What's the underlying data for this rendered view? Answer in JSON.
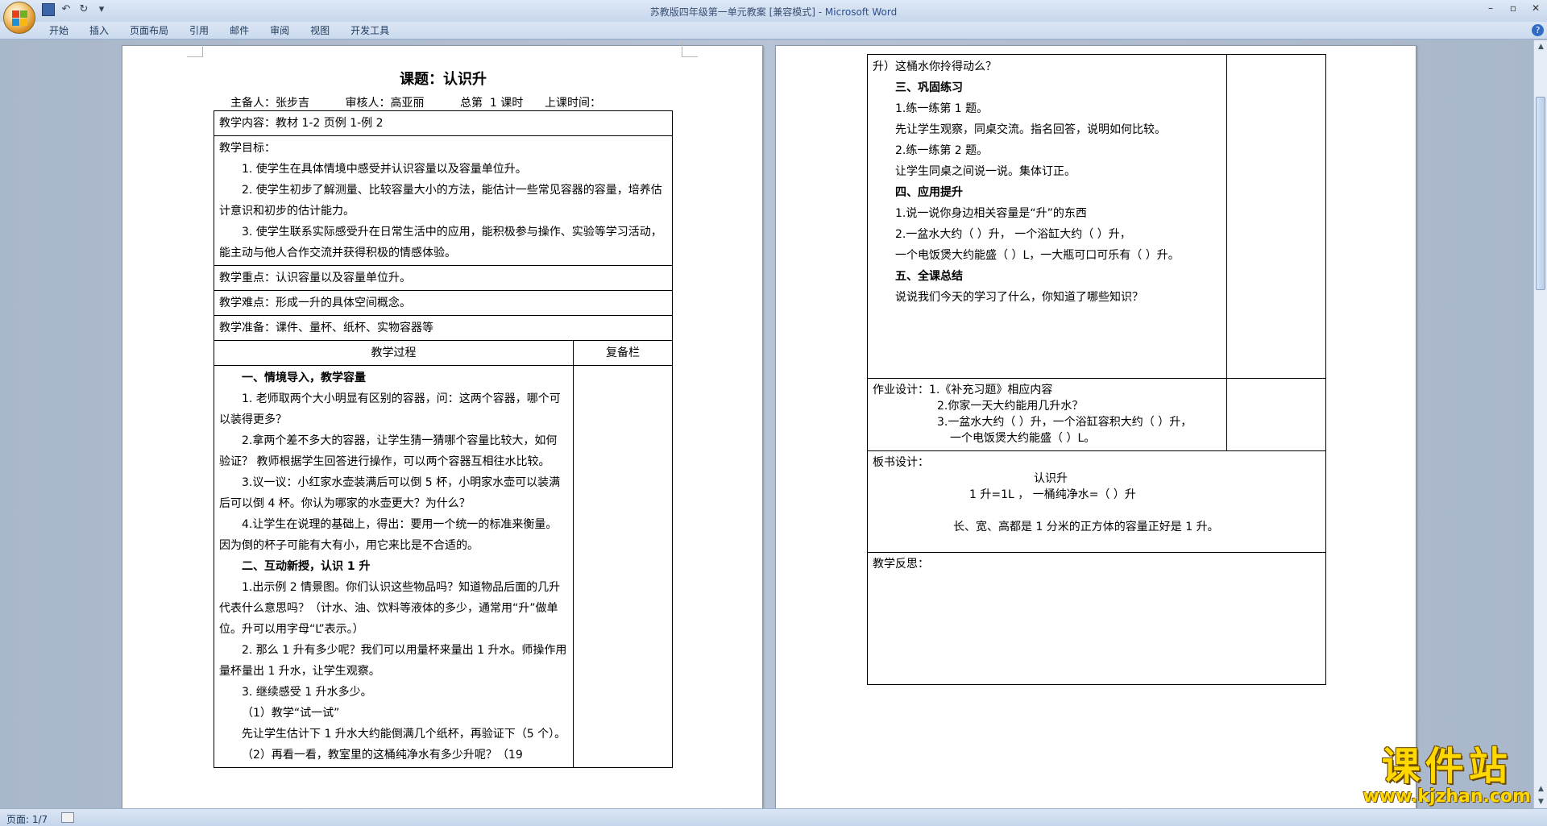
{
  "window": {
    "title_doc": "苏教版四年级第一单元教案 [兼容模式] - ",
    "title_app": "Microsoft Word"
  },
  "ribbon": {
    "tabs": [
      "开始",
      "插入",
      "页面布局",
      "引用",
      "邮件",
      "审阅",
      "视图",
      "开发工具"
    ]
  },
  "status": {
    "page": "页面: 1/7"
  },
  "watermark": {
    "big": "课件站",
    "url": "www.kjzhan.com"
  },
  "page1": {
    "title": "课题：认识升",
    "meta": "主备人：张步吉          审核人：高亚丽          总第  1 课时      上课时间：",
    "content": "教学内容：教材 1-2 页例 1-例 2",
    "goals_heading": "教学目标：",
    "goals": [
      "1. 使学生在具体情境中感受并认识容量以及容量单位升。",
      "2. 使学生初步了解测量、比较容量大小的方法，能估计一些常见容器的容量，培养估计意识和初步的估计能力。",
      "3. 使学生联系实际感受升在日常生活中的应用，能积极参与操作、实验等学习活动，能主动与他人合作交流并获得积极的情感体验。"
    ],
    "key": "教学重点：认识容量以及容量单位升。",
    "difficulty": "教学难点：形成一升的具体空间概念。",
    "prep": "教学准备：课件、量杯、纸杯、实物容器等",
    "process_header": "教学过程",
    "notes_header": "复备栏",
    "process": [
      {
        "bold": true,
        "text": "一、情境导入，教学容量"
      },
      {
        "bold": false,
        "text": "1. 老师取两个大小明显有区别的容器，问：这两个容器，哪个可以装得更多？"
      },
      {
        "bold": false,
        "text": "2.拿两个差不多大的容器，让学生猜一猜哪个容量比较大，如何验证？ 教师根据学生回答进行操作，可以两个容器互相往水比较。"
      },
      {
        "bold": false,
        "text": "3.议一议：小红家水壶装满后可以倒 5 杯，小明家水壶可以装满后可以倒 4 杯。你认为哪家的水壶更大？为什么？"
      },
      {
        "bold": false,
        "text": "4.让学生在说理的基础上，得出：要用一个统一的标准来衡量。因为倒的杯子可能有大有小，用它来比是不合适的。"
      },
      {
        "bold": true,
        "text": "二、互动新授，认识 1 升"
      },
      {
        "bold": false,
        "text": "1.出示例 2 情景图。你们认识这些物品吗？知道物品后面的几升代表什么意思吗？（计水、油、饮料等液体的多少，通常用“升”做单位。升可以用字母“L”表示。）"
      },
      {
        "bold": false,
        "text": "2. 那么 1 升有多少呢？我们可以用量杯来量出 1 升水。师操作用量杯量出 1 升水，让学生观察。"
      },
      {
        "bold": false,
        "text": "3. 继续感受 1 升水多少。"
      },
      {
        "bold": false,
        "text": "（1）教学“试一试”"
      },
      {
        "bold": false,
        "text": "先让学生估计下 1 升水大约能倒满几个纸杯，再验证下（5 个）。"
      },
      {
        "bold": false,
        "text": "（2）再看一看，教室里的这桶纯净水有多少升呢？（19"
      }
    ]
  },
  "page2": {
    "process": [
      {
        "bold": false,
        "indent": false,
        "text": "升）这桶水你拎得动么？"
      },
      {
        "bold": true,
        "indent": true,
        "text": "三、巩固练习"
      },
      {
        "bold": false,
        "indent": true,
        "text": "1.练一练第 1 题。"
      },
      {
        "bold": false,
        "indent": true,
        "text": "先让学生观察，同桌交流。指名回答，说明如何比较。"
      },
      {
        "bold": false,
        "indent": true,
        "text": "2.练一练第 2 题。"
      },
      {
        "bold": false,
        "indent": true,
        "text": "让学生同桌之间说一说。集体订正。"
      },
      {
        "bold": true,
        "indent": true,
        "text": "四、应用提升"
      },
      {
        "bold": false,
        "indent": true,
        "text": "1.说一说你身边相关容量是“升”的东西"
      },
      {
        "bold": false,
        "indent": true,
        "text": "2.一盆水大约（ ）升，          一个浴缸大约（ ）升，"
      },
      {
        "bold": false,
        "indent": true,
        "text": "一个电饭煲大约能盛（ ）L，一大瓶可口可乐有（ ）升。"
      },
      {
        "bold": true,
        "indent": true,
        "text": "五、全课总结"
      },
      {
        "bold": false,
        "indent": true,
        "text": "说说我们今天的学习了什么，你知道了哪些知识？"
      }
    ],
    "homework": [
      "作业设计：1.《补充习题》相应内容",
      "2.你家一天大约能用几升水？",
      "3.一盆水大约（ ）升，一个浴缸容积大约（ ）升，",
      "一个电饭煲大约能盛（ ）L。"
    ],
    "board_heading": "板书设计：",
    "board": [
      "认识升",
      "1 升=1L    ，  一桶纯净水=（ ）升",
      "长、宽、高都是 1 分米的正方体的容量正好是 1 升。"
    ],
    "reflection": "教学反思："
  }
}
